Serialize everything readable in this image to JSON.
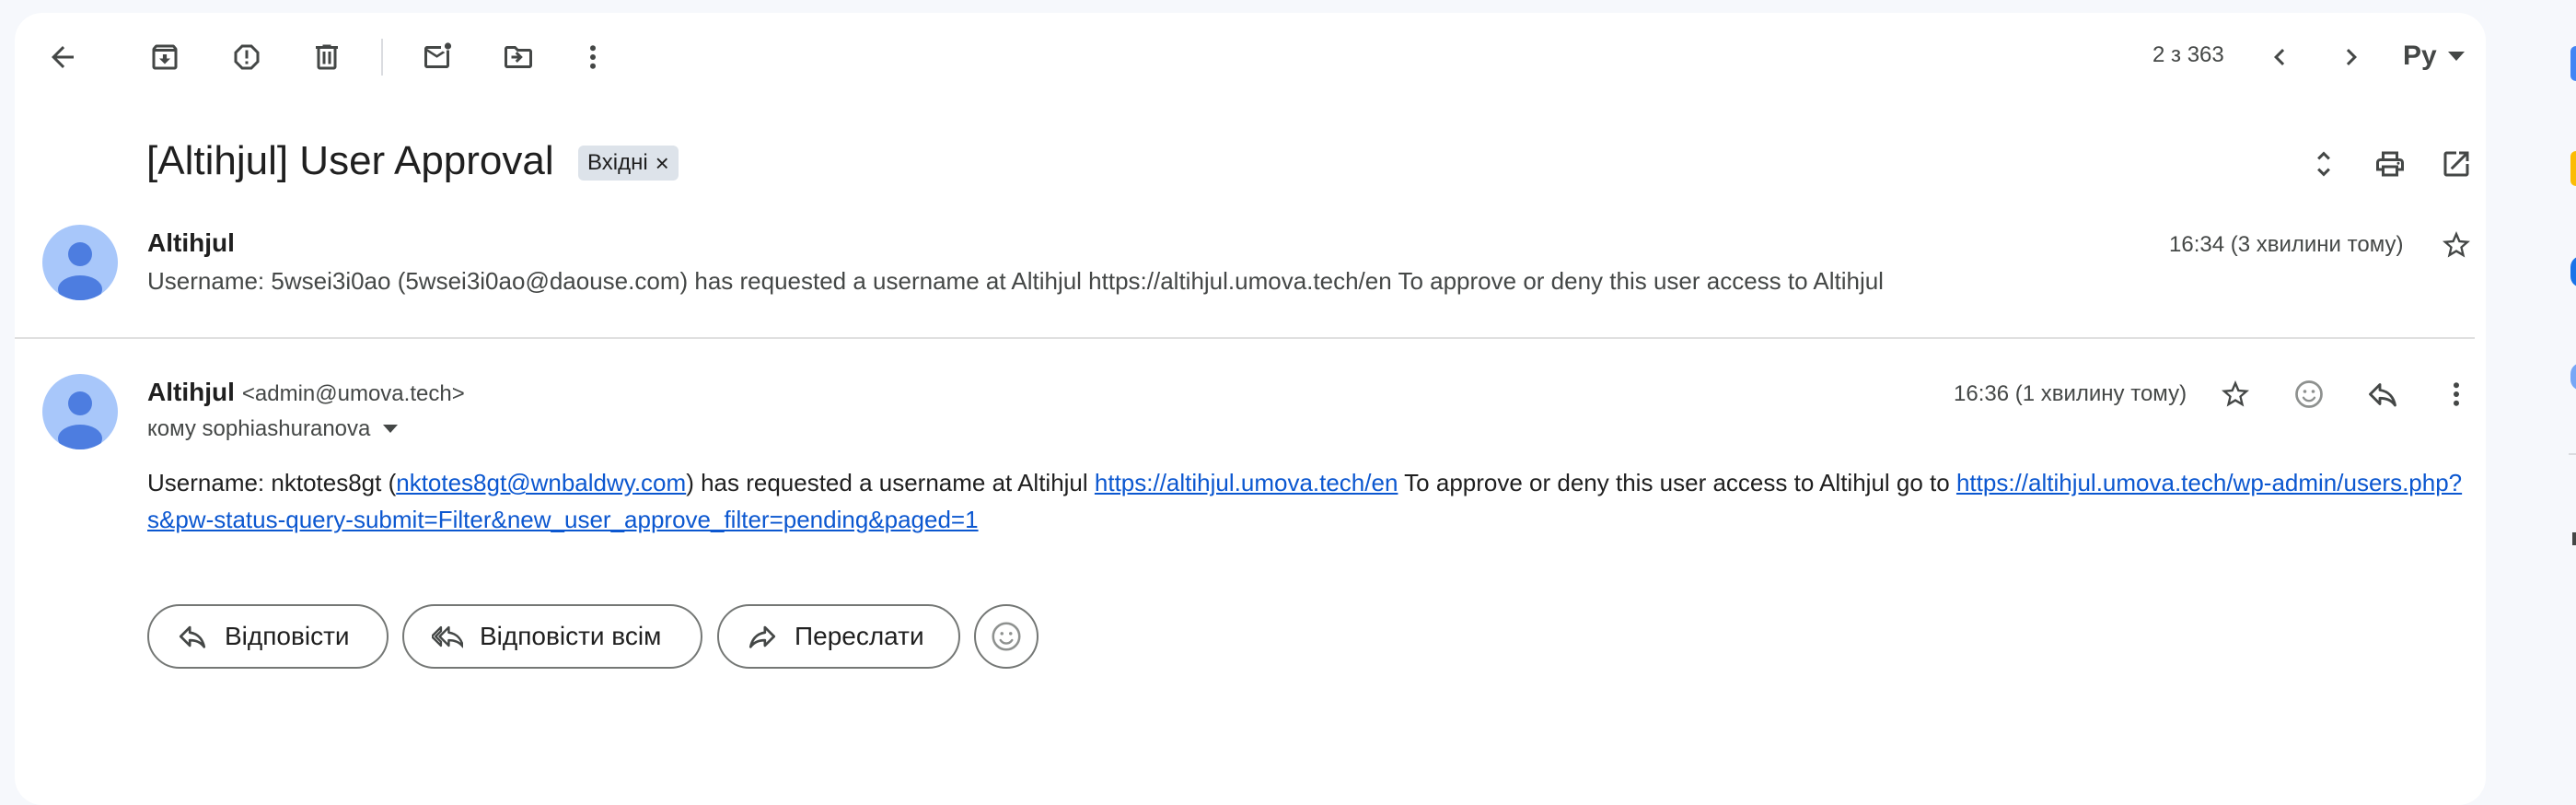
{
  "toolbar": {
    "page_counter": "2 з 363",
    "input_tool": "Ру"
  },
  "message": {
    "subject": "[Altihjul] User Approval",
    "label": "Вхідні"
  },
  "collapsed_email": {
    "sender": "Altihjul",
    "snippet": "Username: 5wsei3i0ao (5wsei3i0ao@daouse.com) has requested a username at Altihjul https://altihjul.umova.tech/en To approve or deny this user access to Altihjul",
    "time": "16:34 (3 хвилини тому)"
  },
  "expanded_email": {
    "sender": "Altihjul",
    "sender_email": "<admin@umova.tech>",
    "recipient": "кому sophiashuranova",
    "time": "16:36 (1 хвилину тому)",
    "body": {
      "part1": "Username: nktotes8gt (",
      "link_email": "nktotes8gt@wnbaldwy.com",
      "part2": ") has requested a username at Altihjul ",
      "link_site": "https://altihjul.umova.tech/en",
      "part3": " To approve or deny this user access to Altihjul go to ",
      "link_admin": "https://altihjul.umova.tech/wp-admin/users.php?s&pw-status-query-submit=Filter&new_user_approve_filter=pending&paged=1"
    }
  },
  "actions": {
    "reply": "Відповісти",
    "reply_all": "Відповісти всім",
    "forward": "Переслати"
  },
  "colors": {
    "link": "#0b57d0",
    "avatar_bg": "#a8c7fa",
    "avatar_fg": "#4d7de0",
    "icon": "#444746"
  }
}
